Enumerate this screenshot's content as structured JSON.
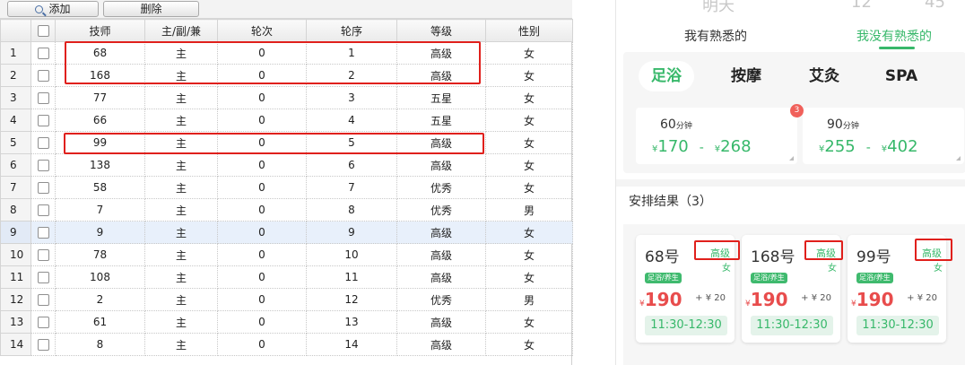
{
  "toolbar": {
    "add_label": "添加",
    "delete_label": "删除"
  },
  "grid": {
    "columns": [
      "技师",
      "主/副/兼",
      "轮次",
      "轮序",
      "等级",
      "性别"
    ],
    "rows": [
      {
        "n": "1",
        "tech": "68",
        "role": "主",
        "round": "0",
        "order": "1",
        "level": "高级",
        "gender": "女"
      },
      {
        "n": "2",
        "tech": "168",
        "role": "主",
        "round": "0",
        "order": "2",
        "level": "高级",
        "gender": "女"
      },
      {
        "n": "3",
        "tech": "77",
        "role": "主",
        "round": "0",
        "order": "3",
        "level": "五星",
        "gender": "女"
      },
      {
        "n": "4",
        "tech": "66",
        "role": "主",
        "round": "0",
        "order": "4",
        "level": "五星",
        "gender": "女"
      },
      {
        "n": "5",
        "tech": "99",
        "role": "主",
        "round": "0",
        "order": "5",
        "level": "高级",
        "gender": "女"
      },
      {
        "n": "6",
        "tech": "138",
        "role": "主",
        "round": "0",
        "order": "6",
        "level": "高级",
        "gender": "女"
      },
      {
        "n": "7",
        "tech": "58",
        "role": "主",
        "round": "0",
        "order": "7",
        "level": "优秀",
        "gender": "女"
      },
      {
        "n": "8",
        "tech": "7",
        "role": "主",
        "round": "0",
        "order": "8",
        "level": "优秀",
        "gender": "男"
      },
      {
        "n": "9",
        "tech": "9",
        "role": "主",
        "round": "0",
        "order": "9",
        "level": "高级",
        "gender": "女"
      },
      {
        "n": "10",
        "tech": "78",
        "role": "主",
        "round": "0",
        "order": "10",
        "level": "高级",
        "gender": "女"
      },
      {
        "n": "11",
        "tech": "108",
        "role": "主",
        "round": "0",
        "order": "11",
        "level": "高级",
        "gender": "女"
      },
      {
        "n": "12",
        "tech": "2",
        "role": "主",
        "round": "0",
        "order": "12",
        "level": "优秀",
        "gender": "男"
      },
      {
        "n": "13",
        "tech": "61",
        "role": "主",
        "round": "0",
        "order": "13",
        "level": "高级",
        "gender": "女"
      },
      {
        "n": "14",
        "tech": "8",
        "role": "主",
        "round": "0",
        "order": "14",
        "level": "高级",
        "gender": "女"
      }
    ]
  },
  "picker_ghost": {
    "day": "明天",
    "hour": "12",
    "minute": "45"
  },
  "familiarity_tabs": {
    "tab1": "我有熟悉的",
    "tab2": "我没有熟悉的"
  },
  "service_tabs": {
    "s1": "足浴",
    "s2": "按摩",
    "s3": "艾灸",
    "s4": "SPA"
  },
  "price_cards": {
    "c1": {
      "minutes": "60",
      "unit": "分钟",
      "yen": "¥",
      "low": "170",
      "dash": "-",
      "high": "268"
    },
    "c2": {
      "minutes": "90",
      "unit": "分钟",
      "yen": "¥",
      "low": "255",
      "dash": "-",
      "high": "402"
    }
  },
  "badge_count": "3",
  "results_title": "安排结果（3）",
  "result_cards": {
    "r1": {
      "num": "68号",
      "level": "高级",
      "gender": "女",
      "tag": "足浴/养生",
      "yen": "¥",
      "price": "190",
      "extra": "+ ¥ 20",
      "time": "11:30-12:30"
    },
    "r2": {
      "num": "168号",
      "level": "高级",
      "gender": "女",
      "tag": "足浴/养生",
      "yen": "¥",
      "price": "190",
      "extra": "+ ¥ 20",
      "time": "11:30-12:30"
    },
    "r3": {
      "num": "99号",
      "level": "高级",
      "gender": "女",
      "tag": "足浴/养生",
      "yen": "¥",
      "price": "190",
      "extra": "+ ¥ 20",
      "time": "11:30-12:30"
    }
  },
  "colors": {
    "accent_green": "#37b86a",
    "price_red": "#e84c4c",
    "highlight_red": "#e0201c",
    "selected_row": "#e8f0fb"
  }
}
